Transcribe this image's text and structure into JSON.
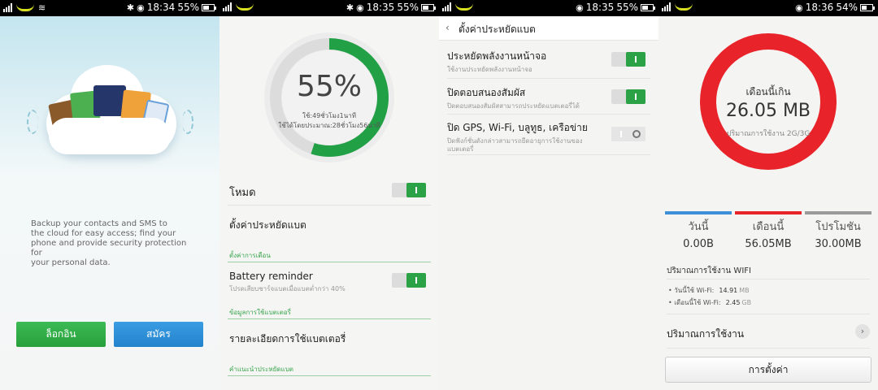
{
  "status_bars": [
    {
      "time": "18:34",
      "battery": "55%",
      "battery_level": 0.55
    },
    {
      "time": "18:35",
      "battery": "55%",
      "battery_level": 0.55
    },
    {
      "time": "18:35",
      "battery": "55%",
      "battery_level": 0.55
    },
    {
      "time": "18:36",
      "battery": "54%",
      "battery_level": 0.54
    }
  ],
  "backup": {
    "description": "Backup your contacts and SMS to\nthe cloud for easy access; find your\nphone and provide security protection for\nyour personal data.",
    "login_label": "ล็อกอิน",
    "signup_label": "สมัคร"
  },
  "battery": {
    "percent_text": "55%",
    "percent_value": 0.55,
    "usage_line1": "ใช้:49ชั่วโมง1นาที",
    "usage_line2": "ใช้ได้โดยประมาณ:28ชั่วโมง56นาที",
    "mode_label": "โหมด",
    "mode_on": true,
    "saver_settings_label": "ตั้งค่าประหยัดแบต",
    "notify_section": "ตั้งค่าการเตือน",
    "reminder_title": "Battery reminder",
    "reminder_sub": "โปรดเสียบชาร์จแบตเมื่อแบตต่ำกว่า 40%",
    "reminder_on": true,
    "usage_section": "ข้อมูลการใช้แบตเตอรี่",
    "usage_details_label": "รายละเอียดการใช้แบตเตอรี่",
    "tips_section": "คำแนะนำประหยัดแบต"
  },
  "saver": {
    "header_title": "ตั้งค่าประหยัดแบต",
    "items": [
      {
        "title": "ประหยัดพลังงานหน้าจอ",
        "sub": "ใช้งานประหยัดพลังงานหน้าจอ",
        "on": true
      },
      {
        "title": "ปิดตอบสนองสัมผัส",
        "sub": "ปิดตอบสนองสัมผัสสามารถประหยัดแบตเตอรี่ได้",
        "on": true
      },
      {
        "title": "ปิด GPS, Wi-Fi, บลูทูธ, เครือข่าย",
        "sub": "ปิดฟังก์ชั่นดังกล่าวสามารถยืดอายุการใช้งานของ\nแบตเตอรี่",
        "on": false
      }
    ]
  },
  "data_usage": {
    "ring_label": "เดือนนี้เกิน",
    "ring_value": "26.05 MB",
    "ring_sub": "ปริมาณการใช้งาน 2G/3G",
    "colors": {
      "ring": "#e8232a",
      "today": "#3d8fd8",
      "month": "#e8232a",
      "promo": "#9a9a9a"
    },
    "stats": [
      {
        "label": "วันนี้",
        "value": "0.00B"
      },
      {
        "label": "เดือนนี้",
        "value": "56.05MB"
      },
      {
        "label": "โปรโมชัน",
        "value": "30.00MB"
      }
    ],
    "wifi_title": "ปริมาณการใช้งาน WIFI",
    "wifi_items": [
      {
        "label": "• วันนี้ใช้ Wi-Fi:",
        "value": "14.91",
        "unit": "MB"
      },
      {
        "label": "• เดือนนี้ใช้ Wi-Fi:",
        "value": "2.45",
        "unit": "GB"
      }
    ],
    "usage_label": "ปริมาณการใช้งาน",
    "settings_label": "การตั้งค่า"
  }
}
